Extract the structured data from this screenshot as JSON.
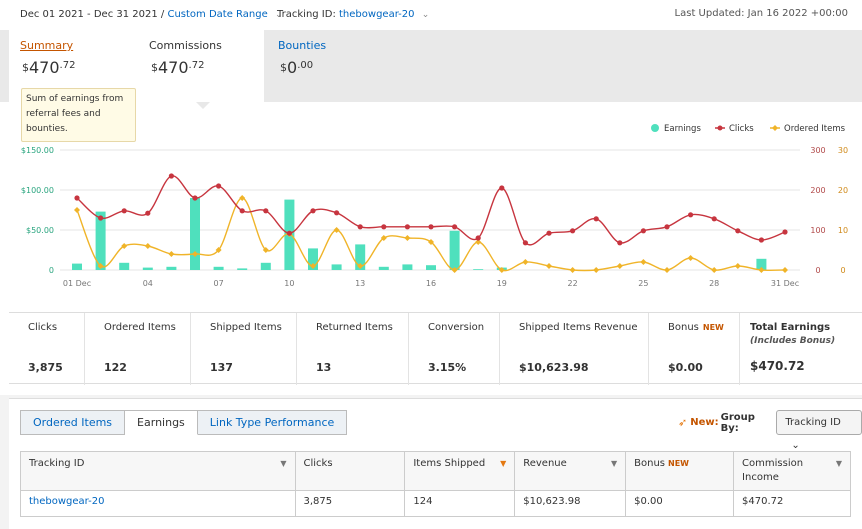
{
  "header": {
    "date_range": "Dec 01 2021 - Dec 31 2021",
    "date_separator": "/",
    "date_option": "Custom Date Range",
    "tracking_label": "Tracking ID:",
    "tracking_value": "thebowgear-20",
    "last_updated": "Last Updated: Jan 16 2022 +00:00"
  },
  "summary_tabs": [
    {
      "label": "Summary",
      "currency": "$",
      "whole": "470",
      "cents": ".72"
    },
    {
      "label": "Commissions",
      "currency": "$",
      "whole": "470",
      "cents": ".72"
    },
    {
      "label": "Bounties",
      "currency": "$",
      "whole": "0",
      "cents": ".00"
    }
  ],
  "tooltip": "Sum of earnings from referral fees and bounties.",
  "chart_data": {
    "type": "bar+line",
    "legend": [
      "Earnings",
      "Clicks",
      "Ordered Items"
    ],
    "legend_position": "top-right",
    "colors": {
      "earnings": "#4fe0bd",
      "clicks": "#c7353f",
      "ordered": "#f0b429"
    },
    "x_ticks": [
      "01 Dec",
      "04",
      "07",
      "10",
      "13",
      "16",
      "19",
      "22",
      "25",
      "28",
      "31 Dec"
    ],
    "y_left_ticks": [
      "$150.00",
      "$100.00",
      "$50.00",
      "0"
    ],
    "y_mid_ticks": [
      "300",
      "200",
      "100",
      "0"
    ],
    "y_right_ticks": [
      "30",
      "20",
      "10",
      "0"
    ],
    "ylim_earnings": [
      0,
      150
    ],
    "ylim_clicks": [
      0,
      300
    ],
    "ylim_ordered": [
      0,
      30
    ],
    "days": [
      1,
      2,
      3,
      4,
      5,
      6,
      7,
      8,
      9,
      10,
      11,
      12,
      13,
      14,
      15,
      16,
      17,
      18,
      19,
      20,
      21,
      22,
      23,
      24,
      25,
      26,
      27,
      28,
      29,
      30,
      31
    ],
    "earnings": [
      8,
      73,
      9,
      3,
      4,
      90,
      4,
      2,
      9,
      88,
      27,
      7,
      32,
      4,
      7,
      6,
      49,
      1,
      3,
      0,
      0,
      0,
      0,
      0,
      0,
      0,
      0,
      0,
      0,
      14,
      0
    ],
    "clicks": [
      180,
      130,
      148,
      142,
      235,
      180,
      210,
      148,
      148,
      92,
      148,
      143,
      108,
      108,
      108,
      108,
      108,
      80,
      205,
      68,
      92,
      98,
      128,
      68,
      98,
      108,
      138,
      128,
      98,
      75,
      95
    ],
    "ordered": [
      15,
      1,
      6,
      6,
      4,
      4,
      5,
      18,
      5,
      9,
      1,
      10,
      1,
      8,
      8,
      7,
      0,
      7,
      0,
      2,
      1,
      0,
      0,
      1,
      2,
      0,
      3,
      0,
      1,
      0,
      0
    ]
  },
  "stats": [
    {
      "title": "Clicks",
      "value": "3,875"
    },
    {
      "title": "Ordered Items",
      "value": "122"
    },
    {
      "title": "Shipped Items",
      "value": "137"
    },
    {
      "title": "Returned Items",
      "value": "13"
    },
    {
      "title": "Conversion",
      "value": "3.15%"
    },
    {
      "title": "Shipped Items Revenue",
      "value": "$10,623.98"
    },
    {
      "title": "Bonus",
      "badge": "NEW",
      "value": "$0.00"
    },
    {
      "title": "Total Earnings",
      "subtitle": "(Includes Bonus)",
      "value": "$470.72"
    }
  ],
  "lower_tabs": [
    "Ordered Items",
    "Earnings",
    "Link Type Performance"
  ],
  "group_by": {
    "new_label": "New:",
    "label": "Group By:",
    "selected": "Tracking ID"
  },
  "table": {
    "headers": [
      "Tracking ID",
      "Clicks",
      "Items Shipped",
      "Revenue",
      "Bonus",
      "Commission Income"
    ],
    "bonus_badge": "NEW",
    "rows": [
      [
        "thebowgear-20",
        "3,875",
        "124",
        "$10,623.98",
        "$0.00",
        "$470.72"
      ]
    ]
  }
}
